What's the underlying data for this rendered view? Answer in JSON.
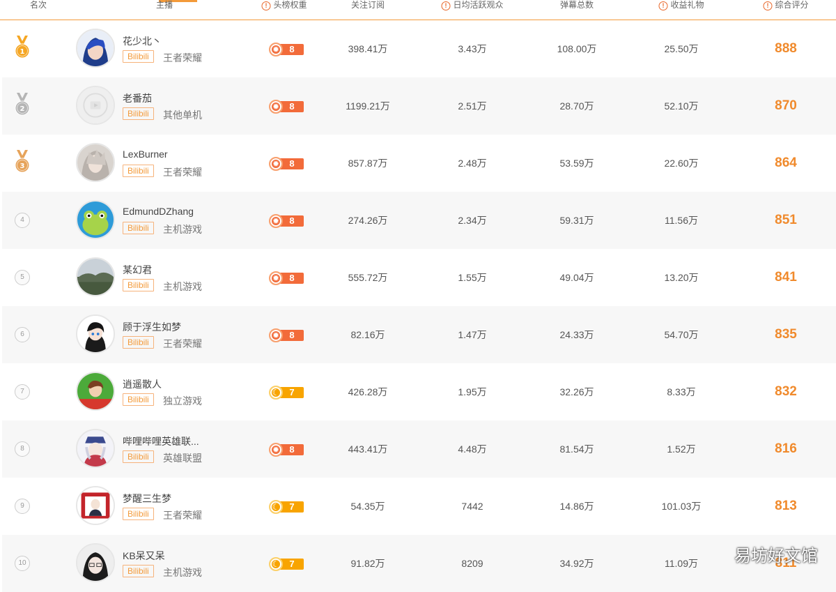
{
  "header": {
    "rank": "名次",
    "streamer": "主播",
    "weight": "头榜权重",
    "subscribers": "关注订阅",
    "daily_active": "日均活跃观众",
    "danmaku": "弹幕总数",
    "gifts": "收益礼物",
    "score": "综合评分"
  },
  "rows": [
    {
      "rank": "1",
      "name": "花少北丶",
      "platform": "Bilibili",
      "category": "王者荣耀",
      "weight": "8",
      "weight_type": "sun",
      "subs": "398.41万",
      "daily": "3.43万",
      "danmaku": "108.00万",
      "gifts": "25.50万",
      "score": "888"
    },
    {
      "rank": "2",
      "name": "老番茄",
      "platform": "Bilibili",
      "category": "其他单机",
      "weight": "8",
      "weight_type": "sun",
      "subs": "1199.21万",
      "daily": "2.51万",
      "danmaku": "28.70万",
      "gifts": "52.10万",
      "score": "870"
    },
    {
      "rank": "3",
      "name": "LexBurner",
      "platform": "Bilibili",
      "category": "王者荣耀",
      "weight": "8",
      "weight_type": "sun",
      "subs": "857.87万",
      "daily": "2.48万",
      "danmaku": "53.59万",
      "gifts": "22.60万",
      "score": "864"
    },
    {
      "rank": "4",
      "name": "EdmundDZhang",
      "platform": "Bilibili",
      "category": "主机游戏",
      "weight": "8",
      "weight_type": "sun",
      "subs": "274.26万",
      "daily": "2.34万",
      "danmaku": "59.31万",
      "gifts": "11.56万",
      "score": "851"
    },
    {
      "rank": "5",
      "name": "某幻君",
      "platform": "Bilibili",
      "category": "主机游戏",
      "weight": "8",
      "weight_type": "sun",
      "subs": "555.72万",
      "daily": "1.55万",
      "danmaku": "49.04万",
      "gifts": "13.20万",
      "score": "841"
    },
    {
      "rank": "6",
      "name": "顾于浮生如梦",
      "platform": "Bilibili",
      "category": "王者荣耀",
      "weight": "8",
      "weight_type": "sun",
      "subs": "82.16万",
      "daily": "1.47万",
      "danmaku": "24.33万",
      "gifts": "54.70万",
      "score": "835"
    },
    {
      "rank": "7",
      "name": "逍遥散人",
      "platform": "Bilibili",
      "category": "独立游戏",
      "weight": "7",
      "weight_type": "moon",
      "subs": "426.28万",
      "daily": "1.95万",
      "danmaku": "32.26万",
      "gifts": "8.33万",
      "score": "832"
    },
    {
      "rank": "8",
      "name": "哔哩哔哩英雄联...",
      "platform": "Bilibili",
      "category": "英雄联盟",
      "weight": "8",
      "weight_type": "sun",
      "subs": "443.41万",
      "daily": "4.48万",
      "danmaku": "81.54万",
      "gifts": "1.52万",
      "score": "816"
    },
    {
      "rank": "9",
      "name": "梦醒三生梦",
      "platform": "Bilibili",
      "category": "王者荣耀",
      "weight": "7",
      "weight_type": "moon",
      "subs": "54.35万",
      "daily": "7442",
      "danmaku": "14.86万",
      "gifts": "101.03万",
      "score": "813"
    },
    {
      "rank": "10",
      "name": "KB呆又呆",
      "platform": "Bilibili",
      "category": "主机游戏",
      "weight": "7",
      "weight_type": "moon",
      "subs": "91.82万",
      "daily": "8209",
      "danmaku": "34.92万",
      "gifts": "11.09万",
      "score": "811"
    }
  ],
  "watermark": "易坊好文馆",
  "colors": {
    "accent": "#f39a3a",
    "score": "#f08a2c",
    "gold": "#f5a623",
    "silver": "#b5b5b5",
    "bronze": "#e6a35a"
  }
}
